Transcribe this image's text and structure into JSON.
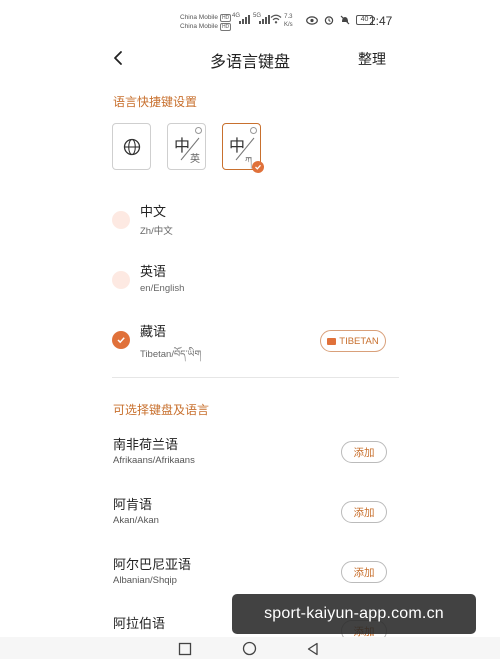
{
  "status_bar": {
    "carrier_1": "China Mobile",
    "carrier_2": "China Mobile",
    "hd_label": "HD",
    "net_1": "4G",
    "net_2": "5G",
    "speed_value": "7.3",
    "speed_unit": "K/s",
    "battery": "40",
    "time": "2:47"
  },
  "header": {
    "title": "多语言键盘",
    "manage_label": "整理"
  },
  "shortcut_section": {
    "title": "语言快捷键设置",
    "layouts": [
      {
        "icon": "globe-icon"
      },
      {
        "big": "中",
        "small": "英"
      },
      {
        "big": "中",
        "small": "ཀ",
        "selected": true
      }
    ]
  },
  "enabled_languages": [
    {
      "name": "中文",
      "sub": "Zh/中文",
      "checked": false
    },
    {
      "name": "英语",
      "sub": "en/English",
      "checked": false
    },
    {
      "name": "藏语",
      "sub": "Tibetan/བོད་ཡིག",
      "checked": true,
      "badge": "TIBETAN"
    }
  ],
  "available_section": {
    "title": "可选择键盘及语言",
    "add_label": "添加",
    "items": [
      {
        "name": "南非荷兰语",
        "sub": "Afrikaans/Afrikaans"
      },
      {
        "name": "阿肯语",
        "sub": "Akan/Akan"
      },
      {
        "name": "阿尔巴尼亚语",
        "sub": "Albanian/Shqip"
      },
      {
        "name": "阿拉伯语",
        "sub": ""
      }
    ]
  },
  "watermark": "sport-kaiyun-app.com.cn",
  "colors": {
    "accent": "#e0713a",
    "accent_text": "#c8702e",
    "radio_idle": "#fde9e2"
  }
}
